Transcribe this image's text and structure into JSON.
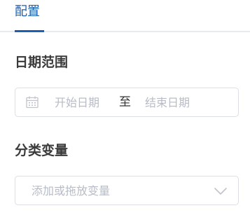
{
  "tabs": [
    {
      "label": "配置",
      "active": true
    }
  ],
  "date_range": {
    "title": "日期范围",
    "start_placeholder": "开始日期",
    "separator": "至",
    "end_placeholder": "结束日期",
    "icon": "calendar-icon"
  },
  "category": {
    "title": "分类变量",
    "placeholder": "添加或拖放变量",
    "icon": "chevron-down-icon"
  },
  "colors": {
    "accent": "#1d5fb3",
    "placeholder": "#b7bcc6",
    "border": "#dcdfe6",
    "divider": "#e7eaf1"
  }
}
